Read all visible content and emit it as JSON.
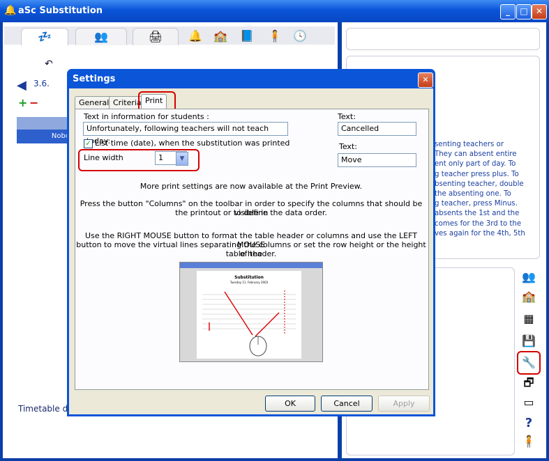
{
  "window": {
    "title": "aSc Substitution",
    "minimize": "_",
    "maximize": "□",
    "close": "✕"
  },
  "left": {
    "date_label": "3.6.",
    "plus": "+",
    "minus": "−",
    "grid_cell": "Nobo",
    "footer": "Timetable da"
  },
  "right_text": {
    "lines": [
      "senting teachers or",
      "They can absent entire",
      "ent only part of day. To",
      "g teacher press plus. To",
      "bsenting teacher, double",
      " the absenting one. To",
      "g teacher, press Minus.",
      "absents the 1st and the",
      "comes for the 3rd to the",
      "ves again for the 4th, 5th"
    ]
  },
  "dialog": {
    "title": "Settings",
    "close": "✕",
    "tabs": [
      "General",
      "Criteria",
      "Print"
    ],
    "students_label": "Text in information for students :",
    "students_value": "Unfortunately, following teachers will not teach today:",
    "list_time_label": "List time (date), when the substitution was printed",
    "list_time_checked": "✓",
    "line_width_label": "Line width",
    "line_width_value": "1",
    "text1_label": "Text:",
    "text1_value": "Cancelled",
    "text2_label": "Text:",
    "text2_value": "Move",
    "info1": "More print settings are now available at the Print Preview.",
    "info2a": "Press the button \"Columns\" on the toolbar in order to specify the columns that should be visible in",
    "info2b": "the printout or to define the data order.",
    "info3a": "Use the RIGHT MOUSE button to format the table header or columns and use the LEFT MOUSE",
    "info3b": "button to move the virtual lines separating the columns or set the row height or the height of the",
    "info3c": "table header.",
    "preview_title": "Substitution",
    "preview_subtitle": "Tuesday 11. February 2003",
    "buttons": {
      "ok": "OK",
      "cancel": "Cancel",
      "apply": "Apply"
    }
  }
}
